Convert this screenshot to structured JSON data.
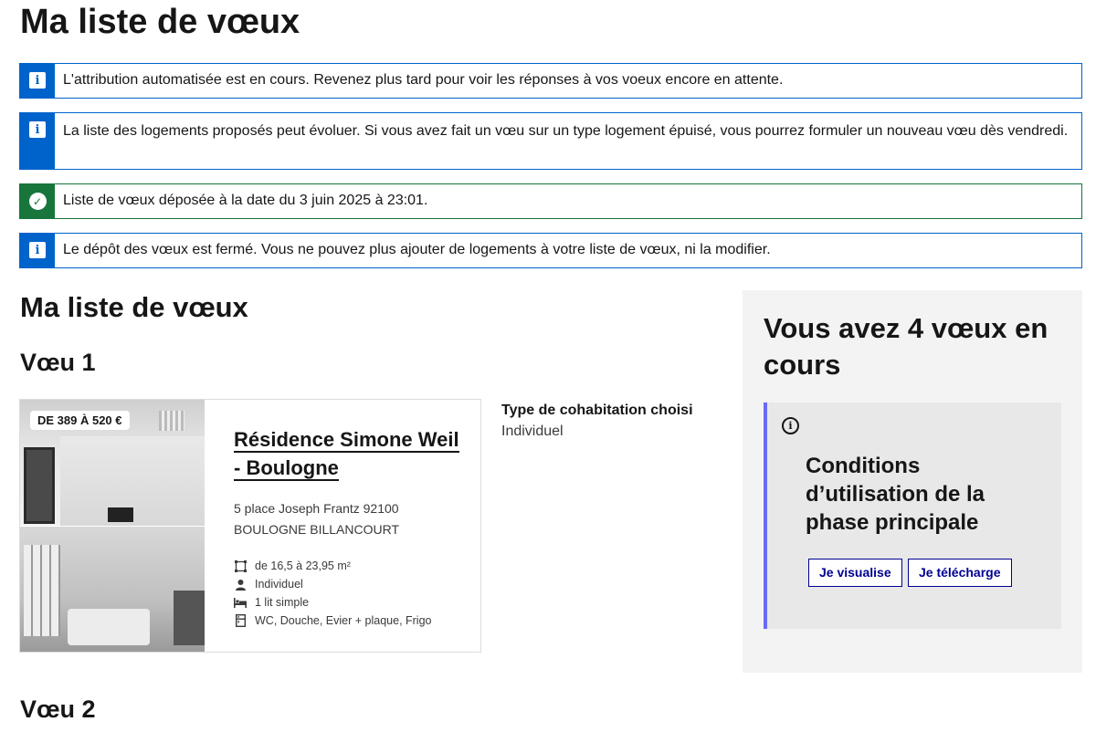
{
  "page": {
    "title": "Ma liste de vœux"
  },
  "alerts": [
    {
      "type": "info",
      "icon": "info-icon",
      "text": "L'attribution automatisée est en cours. Revenez plus tard pour voir les réponses à vos voeux encore en attente."
    },
    {
      "type": "info",
      "icon": "info-icon",
      "text": "La liste des logements proposés peut évoluer. Si vous avez fait un vœu sur un type logement épuisé, vous pourrez formuler un nouveau vœu dès vendredi."
    },
    {
      "type": "success",
      "icon": "check-circle-icon",
      "text": "Liste de vœux déposée à la date du 3 juin 2025 à 23:01."
    },
    {
      "type": "info",
      "icon": "info-icon",
      "text": "Le dépôt des vœux est fermé. Vous ne pouvez plus ajouter de logements à votre liste de vœux, ni la modifier."
    }
  ],
  "main": {
    "section_title": "Ma liste de vœux",
    "voeux": [
      {
        "title": "Vœu 1",
        "price": "DE 389 À 520 €",
        "name": "Résidence Simone Weil - Boulogne",
        "address_line1": "5 place Joseph Frantz 92100",
        "address_line2": "BOULOGNE BILLANCOURT",
        "features": [
          {
            "icon": "surface-icon",
            "text": "de 16,5 à 23,95 m²"
          },
          {
            "icon": "user-icon",
            "text": "Individuel"
          },
          {
            "icon": "bed-icon",
            "text": "1 lit simple"
          },
          {
            "icon": "fridge-icon",
            "text": "WC, Douche, Evier + plaque, Frigo"
          }
        ],
        "cohabitation_label": "Type de cohabitation choisi",
        "cohabitation_value": "Individuel"
      },
      {
        "title": "Vœu 2"
      }
    ]
  },
  "aside": {
    "title": "Vous avez 4 vœux en cours",
    "callout_title": "Conditions d’utilisation de la phase principale",
    "view_button": "Je visualise",
    "download_button": "Je télécharge"
  },
  "colors": {
    "info": "#0063cb",
    "success": "#18753c",
    "primary": "#000091",
    "callout_border": "#6a6af4"
  }
}
